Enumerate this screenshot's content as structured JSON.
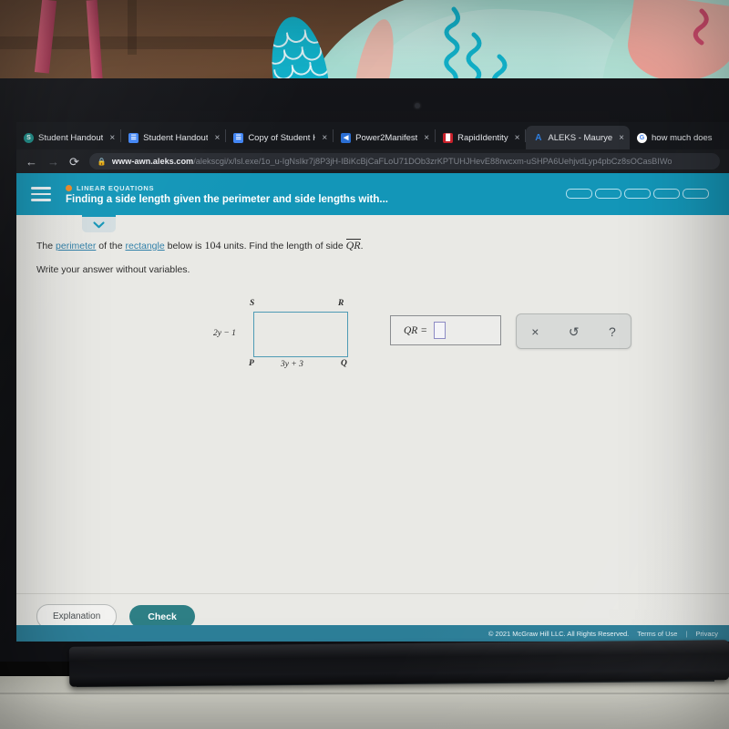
{
  "browser": {
    "tabs": [
      {
        "title": "Student Handout",
        "favicon": "teal-s-icon",
        "active": false
      },
      {
        "title": "Student Handout",
        "favicon": "google-docs-icon",
        "active": false
      },
      {
        "title": "Copy of Student H",
        "favicon": "google-docs-icon",
        "active": false
      },
      {
        "title": "Power2Manifest",
        "favicon": "power2manifest-icon",
        "active": false
      },
      {
        "title": "RapidIdentity",
        "favicon": "rapididentity-icon",
        "active": false
      },
      {
        "title": "ALEKS - Maurye",
        "favicon": "aleks-icon",
        "active": true
      },
      {
        "title": "how much does",
        "favicon": "google-icon",
        "active": false
      }
    ],
    "close_label": "×",
    "nav": {
      "back_icon": "←",
      "forward_icon": "→",
      "reload_icon": "⟳",
      "lock_icon": "🔒"
    },
    "url_domain": "www-awn.aleks.com",
    "url_path": "/alekscgi/x/lsl.exe/1o_u-IgNsIkr7j8P3jH-IBiKcBjCaFLoU71DOb3zrKPTUHJHevE88rwcxm-uSHPA6UehjvdLyp4pbCz8sOCasBIWo"
  },
  "app": {
    "menu_icon": "hamburger-icon",
    "kicker": "LINEAR EQUATIONS",
    "title": "Finding a side length given the perimeter and side lengths with...",
    "progress_pills": 5,
    "collapse_icon": "chevron-down-icon",
    "accent_color": "#1396b8",
    "check_color": "#2e7f85"
  },
  "question": {
    "line1_part1": "The ",
    "link_perimeter": "perimeter",
    "line1_part2": " of the ",
    "link_rectangle": "rectangle",
    "line1_part3": " below is ",
    "value": "104",
    "line1_part4": " units. Find the length of side ",
    "segment": "QR",
    "line1_part5": ".",
    "line2": "Write your answer without variables."
  },
  "figure": {
    "type": "rectangle",
    "vertices": {
      "top_left": "S",
      "top_right": "R",
      "bottom_left": "P",
      "bottom_right": "Q"
    },
    "left_side_label": "2y − 1",
    "bottom_side_label": "3y + 3",
    "stroke_color": "#4f9bb5"
  },
  "answer": {
    "label": "QR =",
    "value": "",
    "placeholder_slot": true
  },
  "toolbar": {
    "clear_icon": "×",
    "undo_icon": "↺",
    "help_icon": "?"
  },
  "actions": {
    "explanation_label": "Explanation",
    "check_label": "Check"
  },
  "footer": {
    "copyright": "© 2021 McGraw Hill LLC. All Rights Reserved.",
    "terms": "Terms of Use",
    "separator": "|",
    "privacy": "Privacy"
  }
}
